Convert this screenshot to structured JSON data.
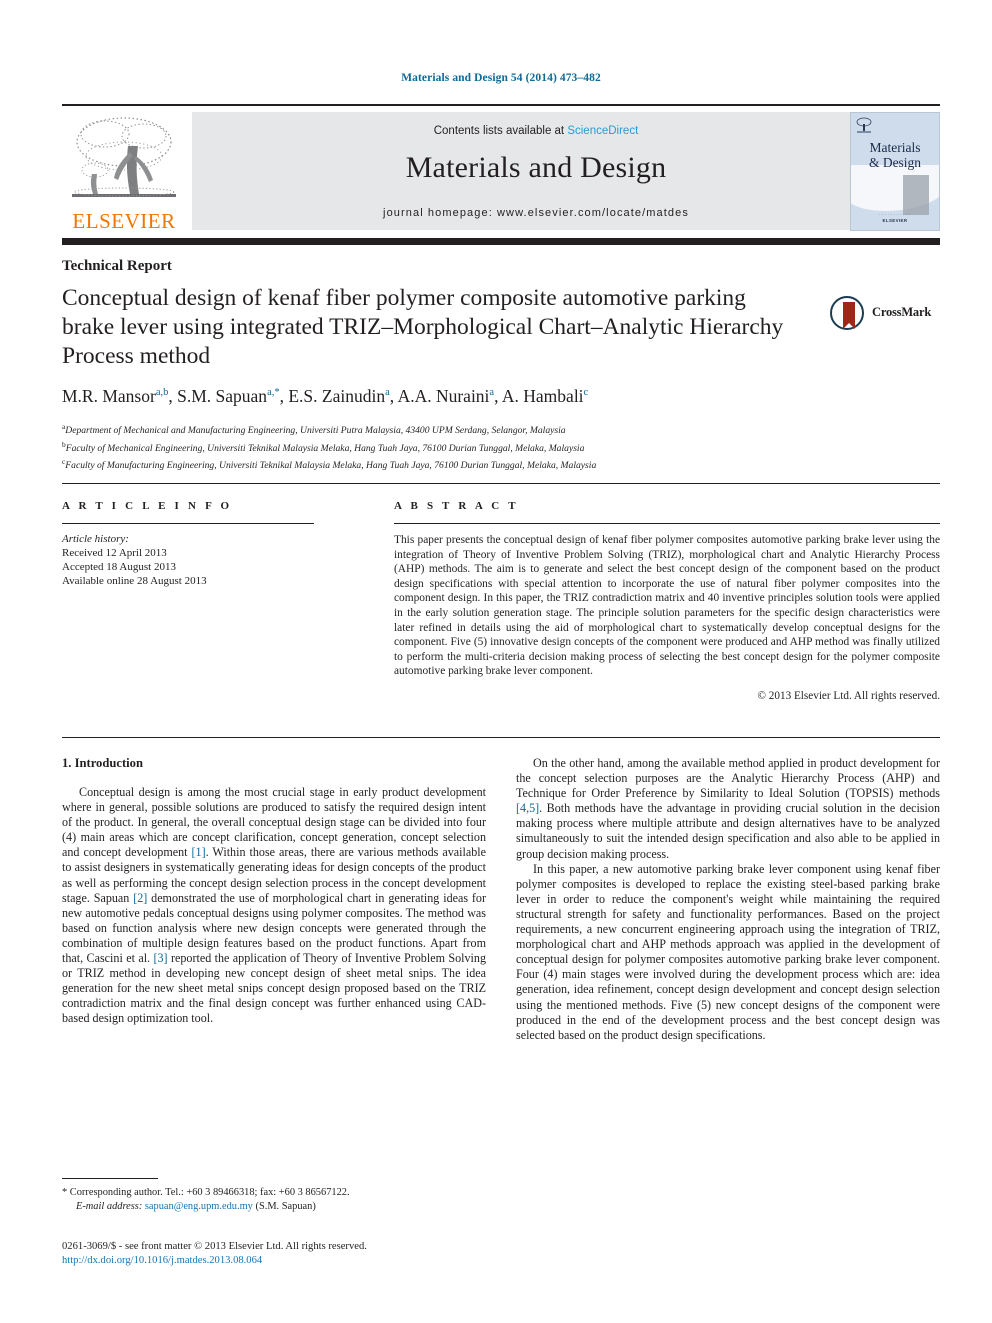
{
  "running_head": "Materials and Design 54 (2014) 473–482",
  "masthead": {
    "publisher_logo_text": "ELSEVIER",
    "contents_prefix": "Contents lists available at ",
    "contents_link": "ScienceDirect",
    "journal_title": "Materials and Design",
    "homepage_label": "journal homepage: www.elsevier.com/locate/matdes",
    "cover": {
      "title_line1": "Materials",
      "title_line2": "& Design",
      "foot_line1": "· · · · · · · · · · ·",
      "foot_line2": "ELSEVIER"
    }
  },
  "article": {
    "section_type": "Technical Report",
    "title": "Conceptual design of kenaf fiber polymer composite automotive parking brake lever using integrated TRIZ–Morphological Chart–Analytic Hierarchy Process method",
    "crossmark_label": "CrossMark",
    "authors": [
      {
        "name": "M.R. Mansor",
        "marks": "a,b"
      },
      {
        "name": "S.M. Sapuan",
        "marks": "a,*"
      },
      {
        "name": "E.S. Zainudin",
        "marks": "a"
      },
      {
        "name": "A.A. Nuraini",
        "marks": "a"
      },
      {
        "name": "A. Hambali",
        "marks": "c"
      }
    ],
    "affiliations": [
      {
        "mark": "a",
        "text": "Department of Mechanical and Manufacturing Engineering, Universiti Putra Malaysia, 43400 UPM Serdang, Selangor, Malaysia"
      },
      {
        "mark": "b",
        "text": "Faculty of Mechanical Engineering, Universiti Teknikal Malaysia Melaka, Hang Tuah Jaya, 76100 Durian Tunggal, Melaka, Malaysia"
      },
      {
        "mark": "c",
        "text": "Faculty of Manufacturing Engineering, Universiti Teknikal Malaysia Melaka, Hang Tuah Jaya, 76100 Durian Tunggal, Melaka, Malaysia"
      }
    ]
  },
  "article_info": {
    "heading": "A R T I C L E   I N F O",
    "history_label": "Article history:",
    "history": [
      "Received 12 April 2013",
      "Accepted 18 August 2013",
      "Available online 28 August 2013"
    ]
  },
  "abstract": {
    "heading": "A B S T R A C T",
    "text": "This paper presents the conceptual design of kenaf fiber polymer composites automotive parking brake lever using the integration of Theory of Inventive Problem Solving (TRIZ), morphological chart and Analytic Hierarchy Process (AHP) methods. The aim is to generate and select the best concept design of the component based on the product design specifications with special attention to incorporate the use of natural fiber polymer composites into the component design. In this paper, the TRIZ contradiction matrix and 40 inventive principles solution tools were applied in the early solution generation stage. The principle solution parameters for the specific design characteristics were later refined in details using the aid of morphological chart to systematically develop conceptual designs for the component. Five (5) innovative design concepts of the component were produced and AHP method was finally utilized to perform the multi-criteria decision making process of selecting the best concept design for the polymer composite automotive parking brake lever component.",
    "copyright": "© 2013 Elsevier Ltd. All rights reserved."
  },
  "body": {
    "section_number_title": "1. Introduction",
    "left_paragraphs": [
      "Conceptual design is among the most crucial stage in early product development where in general, possible solutions are produced to satisfy the required design intent of the product. In general, the overall conceptual design stage can be divided into four (4) main areas which are concept clarification, concept generation, concept selection and concept development [1]. Within those areas, there are various methods available to assist designers in systematically generating ideas for design concepts of the product as well as performing the concept design selection process in the concept development stage. Sapuan [2] demonstrated the use of morphological chart in generating ideas for new automotive pedals conceptual designs using polymer composites. The method was based on function analysis where new design concepts were generated through the combination of multiple design features based on the product functions. Apart from that, Cascini et al. [3] reported the application of Theory of Inventive Problem Solving or TRIZ method in developing new concept design of sheet metal snips. The idea generation for the new sheet metal snips concept design proposed based on the TRIZ contradiction matrix and the final design concept was further enhanced using CAD-based design optimization tool."
    ],
    "right_paragraphs": [
      "On the other hand, among the available method applied in product development for the concept selection purposes are the Analytic Hierarchy Process (AHP) and Technique for Order Preference by Similarity to Ideal Solution (TOPSIS) methods [4,5]. Both methods have the advantage in providing crucial solution in the decision making process where multiple attribute and design alternatives have to be analyzed simultaneously to suit the intended design specification and also able to be applied in group decision making process.",
      "In this paper, a new automotive parking brake lever component using kenaf fiber polymer composites is developed to replace the existing steel-based parking brake lever in order to reduce the component's weight while maintaining the required structural strength for safety and functionality performances. Based on the project requirements, a new concurrent engineering approach using the integration of TRIZ, morphological chart and AHP methods approach was applied in the development of conceptual design for polymer composites automotive parking brake lever component. Four (4) main stages were involved during the development process which are: idea generation, idea refinement, concept design development and concept design selection using the mentioned methods. Five (5) new concept designs of the component were produced in the end of the development process and the best concept design was selected based on the product design specifications."
    ]
  },
  "footnote": {
    "corresponding": "* Corresponding author. Tel.: +60 3 89466318; fax: +60 3 86567122.",
    "email_label": "E-mail address:",
    "email": "sapuan@eng.upm.edu.my",
    "email_owner": "(S.M. Sapuan)"
  },
  "imprint": {
    "line1": "0261-3069/$ - see front matter © 2013 Elsevier Ltd. All rights reserved.",
    "doi": "http://dx.doi.org/10.1016/j.matdes.2013.08.064"
  },
  "colors": {
    "link": "#1774b0",
    "running_head": "#0b6a98",
    "sciencedirect": "#2e9ad0",
    "elsevier_orange": "#ee7601",
    "band_grey": "#e6e7e8",
    "crossmark_red": "#a02718",
    "crossmark_ring": "#1a3d52"
  }
}
